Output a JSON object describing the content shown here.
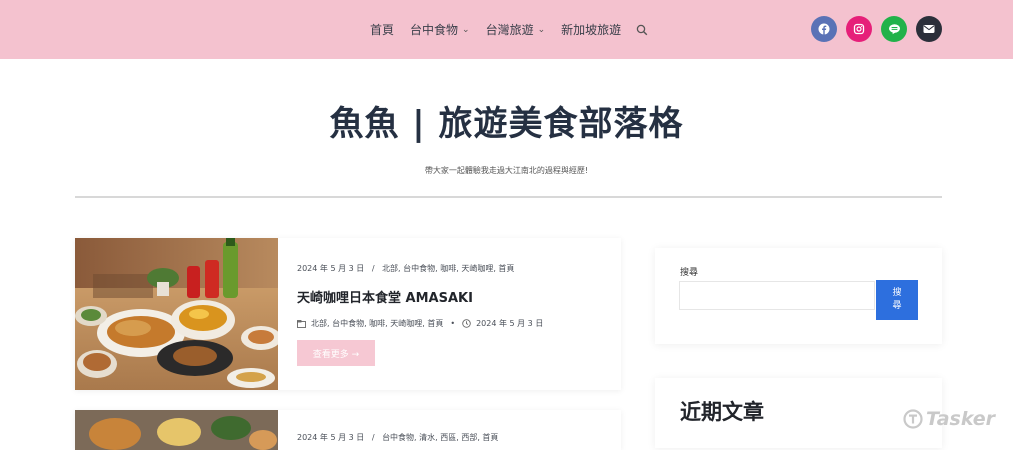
{
  "nav": {
    "items": [
      {
        "label": "首頁",
        "has_dropdown": false
      },
      {
        "label": "台中食物",
        "has_dropdown": true
      },
      {
        "label": "台灣旅遊",
        "has_dropdown": true
      },
      {
        "label": "新加坡旅遊",
        "has_dropdown": false
      }
    ],
    "search_icon": "search-icon",
    "chevron": "⌄"
  },
  "social": [
    {
      "name": "facebook-icon",
      "color": "#5a72b6"
    },
    {
      "name": "instagram-icon",
      "color": "#e61f79"
    },
    {
      "name": "line-icon",
      "color": "#21b24a"
    },
    {
      "name": "email-icon",
      "color": "#2b2f3a"
    }
  ],
  "hero": {
    "title": "魚魚 | 旅遊美食部落格",
    "subtitle": "帶大家一起體驗我走過大江南北的過程與經歷!"
  },
  "posts": [
    {
      "date_meta": "2024 年 5 月 3 日",
      "sep": "/",
      "categories": "北部, 台中食物, 咖啡, 天崎咖哩, 首頁",
      "title": "天崎咖哩日本食堂 AMASAKI",
      "tags": "北部, 台中食物, 咖啡, 天崎咖哩, 首頁",
      "dot": "•",
      "date": "2024 年 5 月 3 日",
      "read_more": "查看更多 →"
    },
    {
      "date_meta": "2024 年 5 月 3 日",
      "sep": "/",
      "categories": "台中食物, 清水, 西區, 西部, 首頁"
    }
  ],
  "sidebar": {
    "search_label": "搜尋",
    "search_value": "",
    "search_button": "搜\n尋",
    "recent_title": "近期文章"
  },
  "watermark": "Tasker",
  "colors": {
    "topbar": "#f4c2cf",
    "accent": "#2d6fde",
    "readmore": "#f6c8d3"
  }
}
